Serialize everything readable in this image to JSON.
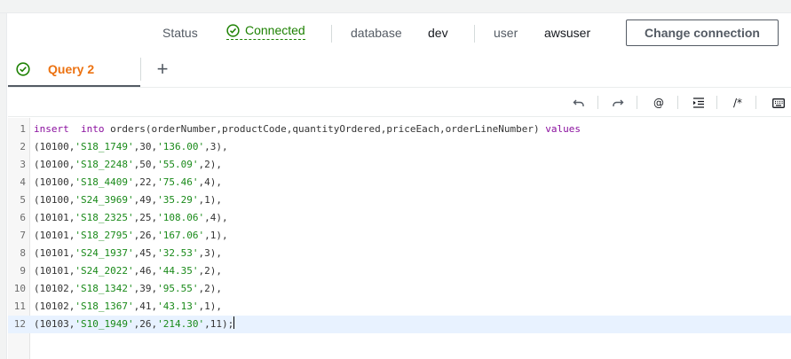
{
  "status_bar": {
    "status_label": "Status",
    "status_value": "Connected",
    "database_label": "database",
    "database_value": "dev",
    "user_label": "user",
    "user_value": "awsuser",
    "change_connection_label": "Change connection"
  },
  "tabs": [
    {
      "label": "Query 2",
      "active": true
    }
  ],
  "add_tab_label": "+",
  "toolbar": {
    "undo": "undo-icon",
    "redo": "redo-icon",
    "at_label": "@",
    "indent": "indent-icon",
    "comment_label": "/*",
    "keyboard": "keyboard-icon"
  },
  "editor": {
    "lines": [
      {
        "num": "1",
        "tokens": [
          {
            "t": "insert",
            "c": "kw"
          },
          {
            "t": "  ",
            "c": ""
          },
          {
            "t": "into",
            "c": "kw"
          },
          {
            "t": " orders(orderNumber,productCode,quantityOrdered,priceEach,orderLineNumber) ",
            "c": ""
          },
          {
            "t": "values",
            "c": "kw"
          }
        ]
      },
      {
        "num": "2",
        "tokens": [
          {
            "t": "(10100,",
            "c": ""
          },
          {
            "t": "'S18_1749'",
            "c": "str"
          },
          {
            "t": ",30,",
            "c": ""
          },
          {
            "t": "'136.00'",
            "c": "str"
          },
          {
            "t": ",3),",
            "c": ""
          }
        ]
      },
      {
        "num": "3",
        "tokens": [
          {
            "t": "(10100,",
            "c": ""
          },
          {
            "t": "'S18_2248'",
            "c": "str"
          },
          {
            "t": ",50,",
            "c": ""
          },
          {
            "t": "'55.09'",
            "c": "str"
          },
          {
            "t": ",2),",
            "c": ""
          }
        ]
      },
      {
        "num": "4",
        "tokens": [
          {
            "t": "(10100,",
            "c": ""
          },
          {
            "t": "'S18_4409'",
            "c": "str"
          },
          {
            "t": ",22,",
            "c": ""
          },
          {
            "t": "'75.46'",
            "c": "str"
          },
          {
            "t": ",4),",
            "c": ""
          }
        ]
      },
      {
        "num": "5",
        "tokens": [
          {
            "t": "(10100,",
            "c": ""
          },
          {
            "t": "'S24_3969'",
            "c": "str"
          },
          {
            "t": ",49,",
            "c": ""
          },
          {
            "t": "'35.29'",
            "c": "str"
          },
          {
            "t": ",1),",
            "c": ""
          }
        ]
      },
      {
        "num": "6",
        "tokens": [
          {
            "t": "(10101,",
            "c": ""
          },
          {
            "t": "'S18_2325'",
            "c": "str"
          },
          {
            "t": ",25,",
            "c": ""
          },
          {
            "t": "'108.06'",
            "c": "str"
          },
          {
            "t": ",4),",
            "c": ""
          }
        ]
      },
      {
        "num": "7",
        "tokens": [
          {
            "t": "(10101,",
            "c": ""
          },
          {
            "t": "'S18_2795'",
            "c": "str"
          },
          {
            "t": ",26,",
            "c": ""
          },
          {
            "t": "'167.06'",
            "c": "str"
          },
          {
            "t": ",1),",
            "c": ""
          }
        ]
      },
      {
        "num": "8",
        "tokens": [
          {
            "t": "(10101,",
            "c": ""
          },
          {
            "t": "'S24_1937'",
            "c": "str"
          },
          {
            "t": ",45,",
            "c": ""
          },
          {
            "t": "'32.53'",
            "c": "str"
          },
          {
            "t": ",3),",
            "c": ""
          }
        ]
      },
      {
        "num": "9",
        "tokens": [
          {
            "t": "(10101,",
            "c": ""
          },
          {
            "t": "'S24_2022'",
            "c": "str"
          },
          {
            "t": ",46,",
            "c": ""
          },
          {
            "t": "'44.35'",
            "c": "str"
          },
          {
            "t": ",2),",
            "c": ""
          }
        ]
      },
      {
        "num": "10",
        "tokens": [
          {
            "t": "(10102,",
            "c": ""
          },
          {
            "t": "'S18_1342'",
            "c": "str"
          },
          {
            "t": ",39,",
            "c": ""
          },
          {
            "t": "'95.55'",
            "c": "str"
          },
          {
            "t": ",2),",
            "c": ""
          }
        ]
      },
      {
        "num": "11",
        "tokens": [
          {
            "t": "(10102,",
            "c": ""
          },
          {
            "t": "'S18_1367'",
            "c": "str"
          },
          {
            "t": ",41,",
            "c": ""
          },
          {
            "t": "'43.13'",
            "c": "str"
          },
          {
            "t": ",1),",
            "c": ""
          }
        ]
      },
      {
        "num": "12",
        "active": true,
        "tokens": [
          {
            "t": "(10103,",
            "c": ""
          },
          {
            "t": "'S10_1949'",
            "c": "str"
          },
          {
            "t": ",26,",
            "c": ""
          },
          {
            "t": "'214.30'",
            "c": "str"
          },
          {
            "t": ",11);",
            "c": ""
          }
        ]
      }
    ]
  },
  "colors": {
    "connected": "#1d8102",
    "tab_active": "#ec7211",
    "keyword": "#8a0f9e",
    "string": "#1a8a1a",
    "active_line": "#e8f2ff"
  }
}
